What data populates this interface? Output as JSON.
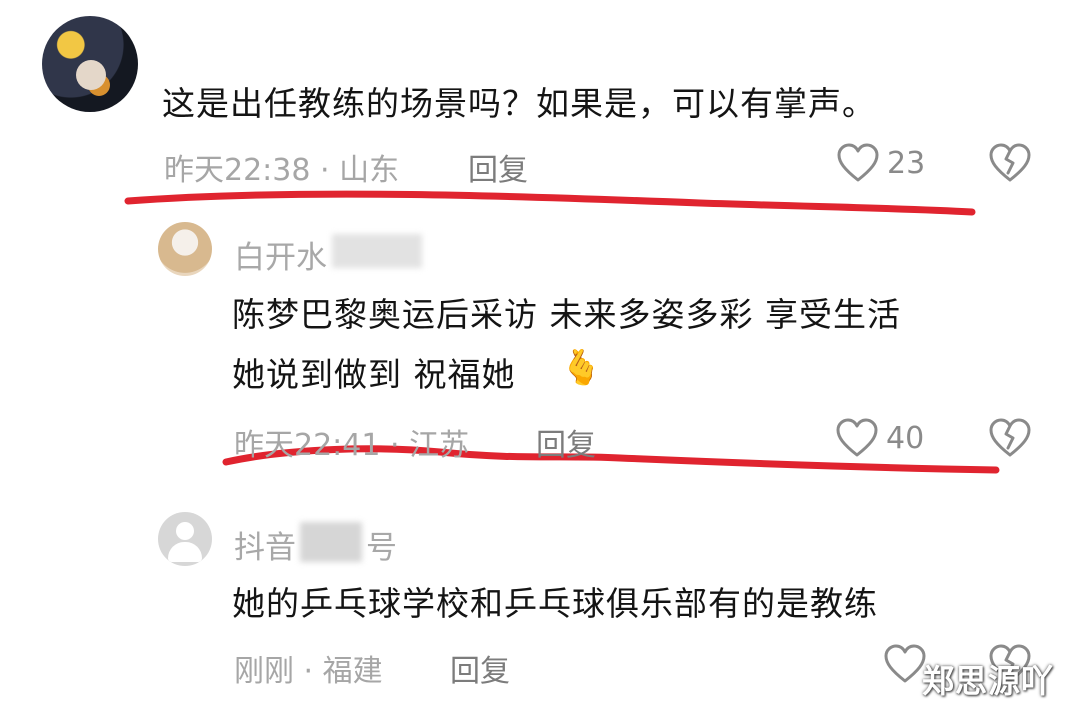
{
  "comments": [
    {
      "username": "",
      "text_lines": [
        "这是出任教练的场景吗？如果是，可以有掌声。"
      ],
      "time": "昨天22:38 · 山东",
      "reply": "回复",
      "likes": "23"
    },
    {
      "username": "白开水",
      "text_lines": [
        "陈梦巴黎奥运后采访 未来多姿多彩 享受生活",
        "她说到做到 祝福她"
      ],
      "emoji": "🫰",
      "time": "昨天22:41 · 江苏",
      "reply": "回复",
      "likes": "40"
    },
    {
      "username": "抖音",
      "username_suffix": "号",
      "text_lines": [
        "她的乒乓球学校和乒乓球俱乐部有的是教练"
      ],
      "time": "刚刚 · 福建",
      "reply": "回复",
      "likes": ""
    }
  ],
  "watermark": "郑思源吖",
  "icons": {
    "like": "heart-outline-icon",
    "dislike": "broken-heart-icon"
  },
  "colors": {
    "annotation_red": "#e0242f",
    "meta_gray": "#a6a6a6"
  }
}
